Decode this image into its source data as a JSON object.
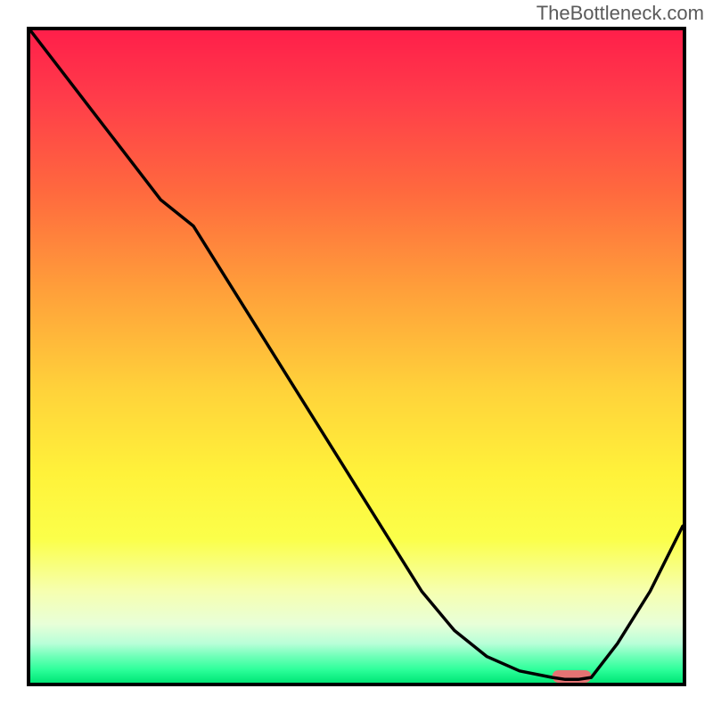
{
  "attribution": "TheBottleneck.com",
  "chart_data": {
    "type": "line",
    "title": "",
    "xlabel": "",
    "ylabel": "",
    "x": [
      0.0,
      0.05,
      0.1,
      0.15,
      0.2,
      0.25,
      0.3,
      0.35,
      0.4,
      0.45,
      0.5,
      0.55,
      0.6,
      0.65,
      0.7,
      0.75,
      0.8,
      0.82,
      0.84,
      0.86,
      0.9,
      0.95,
      1.0
    ],
    "values": [
      1.0,
      0.935,
      0.87,
      0.805,
      0.74,
      0.7,
      0.62,
      0.54,
      0.46,
      0.38,
      0.3,
      0.22,
      0.14,
      0.08,
      0.04,
      0.018,
      0.008,
      0.005,
      0.005,
      0.008,
      0.06,
      0.14,
      0.24
    ],
    "ylim": [
      0,
      1
    ],
    "xlim": [
      0,
      1
    ],
    "marker": {
      "x_center": 0.83,
      "width_frac": 0.06,
      "color": "#e57373"
    },
    "gradient_stops": [
      {
        "pos": 0.0,
        "color": "#ff1f4a"
      },
      {
        "pos": 0.25,
        "color": "#ff6a3e"
      },
      {
        "pos": 0.55,
        "color": "#ffd23a"
      },
      {
        "pos": 0.78,
        "color": "#fbff4a"
      },
      {
        "pos": 0.94,
        "color": "#b8ffd8"
      },
      {
        "pos": 1.0,
        "color": "#00e676"
      }
    ]
  }
}
